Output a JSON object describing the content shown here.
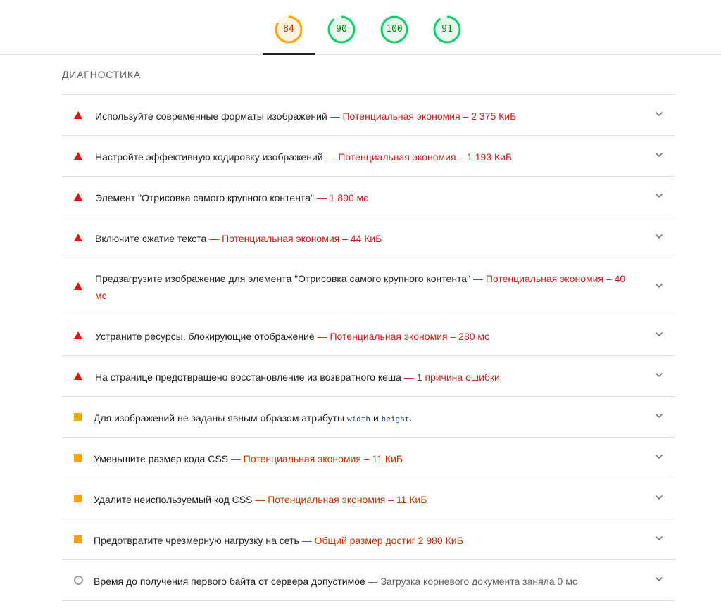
{
  "colors": {
    "fail": "#eb0f00",
    "average": "#ffa400",
    "pass": "#0cce6b",
    "fail_text": "#c5221f",
    "average_text": "#c33300"
  },
  "gauges": [
    {
      "score": "84",
      "fraction": 0.84,
      "status": "average",
      "active": true
    },
    {
      "score": "90",
      "fraction": 0.9,
      "status": "pass",
      "active": false
    },
    {
      "score": "100",
      "fraction": 1.0,
      "status": "pass",
      "active": false
    },
    {
      "score": "91",
      "fraction": 0.91,
      "status": "pass",
      "active": false
    }
  ],
  "section_title": "ДИАГНОСТИКА",
  "audits": [
    {
      "status": "fail",
      "title": "Используйте современные форматы изображений",
      "display": "— Потенциальная экономия – 2 375 КиБ",
      "icon": "expand-chevron-icon"
    },
    {
      "status": "fail",
      "title": "Настройте эффективную кодировку изображений",
      "display": "— Потенциальная экономия – 1 193 КиБ",
      "icon": "expand-chevron-icon"
    },
    {
      "status": "fail",
      "title": "Элемент \"Отрисовка самого крупного контента\"",
      "display": "— 1 890 мс",
      "icon": "expand-chevron-icon"
    },
    {
      "status": "fail",
      "title": "Включите сжатие текста",
      "display": "— Потенциальная экономия – 44 КиБ",
      "icon": "expand-chevron-icon"
    },
    {
      "status": "fail",
      "title": "Предзагрузите изображение для элемента \"Отрисовка самого крупного контента\"",
      "display": "— Потенциальная экономия – 40 мс",
      "icon": "expand-chevron-icon"
    },
    {
      "status": "fail",
      "title": "Устраните ресурсы, блокирующие отображение",
      "display": "— Потенциальная экономия – 280 мс",
      "icon": "expand-chevron-icon"
    },
    {
      "status": "fail",
      "title": "На странице предотвращено восстановление из возвратного кеша",
      "display": "— 1 причина ошибки",
      "icon": "expand-chevron-icon"
    },
    {
      "status": "average",
      "title_before": "Для изображений не заданы явным образом атрибуты",
      "code1": "width",
      "between": "и",
      "code2": "height",
      "after": ".",
      "icon": "expand-chevron-icon"
    },
    {
      "status": "average",
      "title": "Уменьшите размер кода CSS",
      "display": "— Потенциальная экономия – 11 КиБ",
      "icon": "expand-chevron-icon"
    },
    {
      "status": "average",
      "title": "Удалите неиспользуемый код CSS",
      "display": "— Потенциальная экономия – 11 КиБ",
      "icon": "expand-chevron-icon"
    },
    {
      "status": "average",
      "title": "Предотвратите чрезмерную нагрузку на сеть",
      "display": "— Общий размер достиг 2 980 КиБ",
      "icon": "expand-chevron-icon"
    },
    {
      "status": "info",
      "title": "Время до получения первого байта от сервера допустимое",
      "display": "— Загрузка корневого документа заняла 0 мс",
      "icon": "expand-chevron-icon"
    }
  ]
}
